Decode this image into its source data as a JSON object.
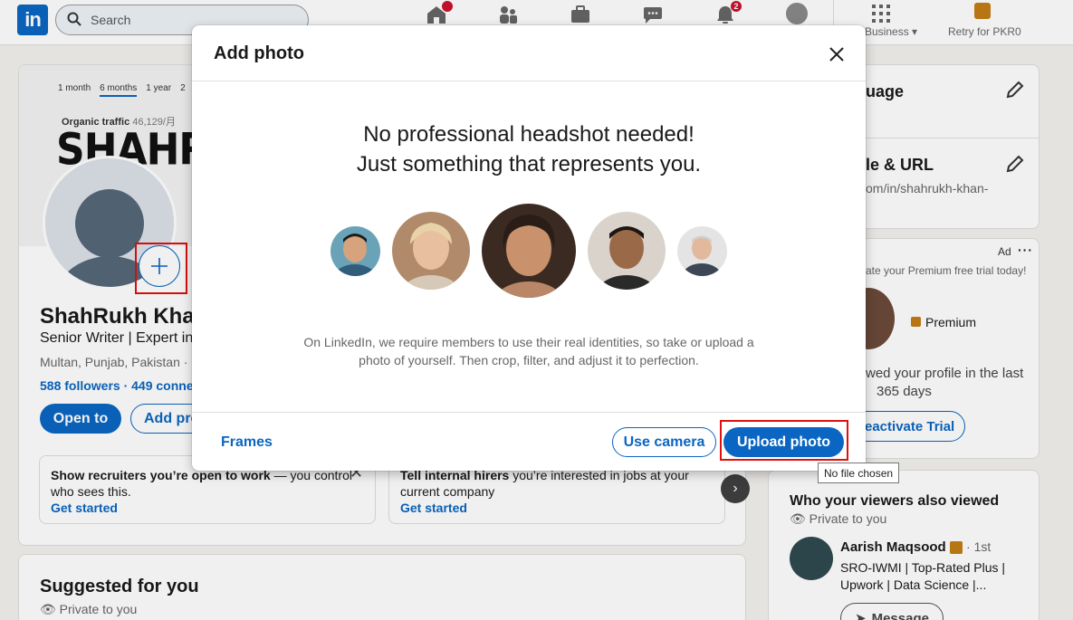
{
  "nav": {
    "search_placeholder": "Search",
    "messaging_badge": "",
    "notifications_badge": "2",
    "business_label": "Business",
    "premium_label": "Retry for PKR0"
  },
  "profile": {
    "range_1m": "1 month",
    "range_6m": "6 months",
    "range_1y": "1 year",
    "range_more": "2",
    "organic_label": "Organic traffic",
    "organic_value": "46,129/月",
    "cover_text": "SHAHRUKH",
    "name": "ShahRukh Khan",
    "headline": "Senior Writer | Expert in",
    "location": "Multan, Punjab, Pakistan ·",
    "followers": "588 followers",
    "connections": "· 449 conne",
    "open_to": "Open to",
    "add_profile": "Add pro",
    "card1_bold": "Show recruiters you’re open to work",
    "card1_rest": " — you control who sees this.",
    "card1_cta": "Get started",
    "card2_bold": "Tell internal hirers",
    "card2_rest": " you’re interested in jobs at your current company",
    "card2_cta": "Get started",
    "suggested_title": "Suggested for you",
    "suggested_sub": "Private to you"
  },
  "right": {
    "language_title": "uage",
    "url_title": "le & URL",
    "url_value": "om/in/shahrukh-khan-",
    "ad_label": "Ad",
    "premium_trial": "ate your Premium free trial today!",
    "premium_label": "Premium",
    "viewed_line1": "wed your profile in the last",
    "viewed_line2": "365 days",
    "reactivate": "eactivate Trial",
    "viewers_title": "Who your viewers also viewed",
    "viewers_sub": "Private to you",
    "person_name": "Aarish Maqsood",
    "person_degree": "· 1st",
    "person_line1": "SRO-IWMI | Top-Rated Plus |",
    "person_line2": "Upwork | Data Science |...",
    "message": "Message"
  },
  "modal": {
    "title": "Add photo",
    "headline_1": "No professional headshot needed!",
    "headline_2": "Just something that represents you.",
    "description": "On LinkedIn, we require members to use their real identities, so take or upload a photo of yourself. Then crop, filter, and adjust it to perfection.",
    "frames": "Frames",
    "use_camera": "Use camera",
    "upload_photo": "Upload photo"
  },
  "tooltip": "No file chosen",
  "colors": {
    "brand": "#0a66c2",
    "highlight": "#e01010"
  }
}
